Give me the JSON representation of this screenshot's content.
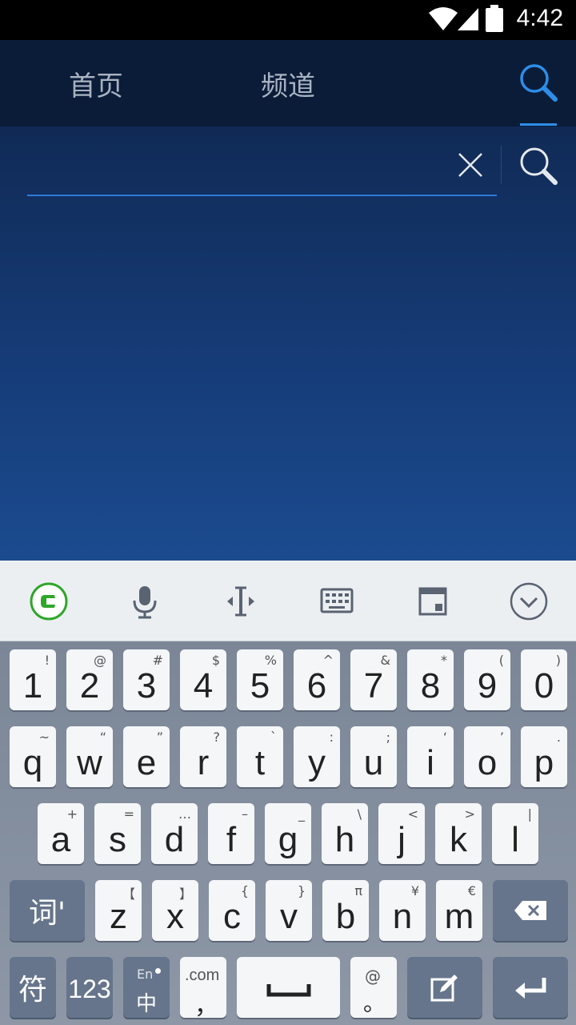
{
  "status": {
    "time": "4:42"
  },
  "header": {
    "tabs": [
      {
        "label": "首页"
      },
      {
        "label": "频道"
      }
    ],
    "accent": "#2d8ee8"
  },
  "search": {
    "value": "",
    "placeholder": ""
  },
  "keyboard": {
    "toolbar": [
      "logo-icon",
      "microphone-icon",
      "cursor-icon",
      "keyboard-layout-icon",
      "window-icon",
      "collapse-icon"
    ],
    "row1": [
      {
        "k": "1",
        "s": "!"
      },
      {
        "k": "2",
        "s": "@"
      },
      {
        "k": "3",
        "s": "#"
      },
      {
        "k": "4",
        "s": "$"
      },
      {
        "k": "5",
        "s": "%"
      },
      {
        "k": "6",
        "s": "^"
      },
      {
        "k": "7",
        "s": "&"
      },
      {
        "k": "8",
        "s": "*"
      },
      {
        "k": "9",
        "s": "("
      },
      {
        "k": "0",
        "s": ")"
      }
    ],
    "row2": [
      {
        "k": "q",
        "s": "~"
      },
      {
        "k": "w",
        "s": "“"
      },
      {
        "k": "e",
        "s": "”"
      },
      {
        "k": "r",
        "s": "?"
      },
      {
        "k": "t",
        "s": "`"
      },
      {
        "k": "y",
        "s": ":"
      },
      {
        "k": "u",
        "s": ";"
      },
      {
        "k": "i",
        "s": "‘"
      },
      {
        "k": "o",
        "s": "’"
      },
      {
        "k": "p",
        "s": "."
      }
    ],
    "row3": [
      {
        "k": "a",
        "s": "+"
      },
      {
        "k": "s",
        "s": "="
      },
      {
        "k": "d",
        "s": "…"
      },
      {
        "k": "f",
        "s": "–"
      },
      {
        "k": "g",
        "s": "_"
      },
      {
        "k": "h",
        "s": "\\"
      },
      {
        "k": "j",
        "s": "<"
      },
      {
        "k": "k",
        "s": ">"
      },
      {
        "k": "l",
        "s": "|"
      }
    ],
    "row4_left": "词'",
    "row4": [
      {
        "k": "z",
        "s": "【"
      },
      {
        "k": "x",
        "s": "】"
      },
      {
        "k": "c",
        "s": "{"
      },
      {
        "k": "v",
        "s": "}"
      },
      {
        "k": "b",
        "s": "π"
      },
      {
        "k": "n",
        "s": "¥"
      },
      {
        "k": "m",
        "s": "€"
      }
    ],
    "row5": {
      "symbols": "符",
      "numbers": "123",
      "lang_top": "En",
      "lang_bottom": "中",
      "com": ".com",
      "comma": "，",
      "at": "@",
      "period": "。"
    }
  }
}
